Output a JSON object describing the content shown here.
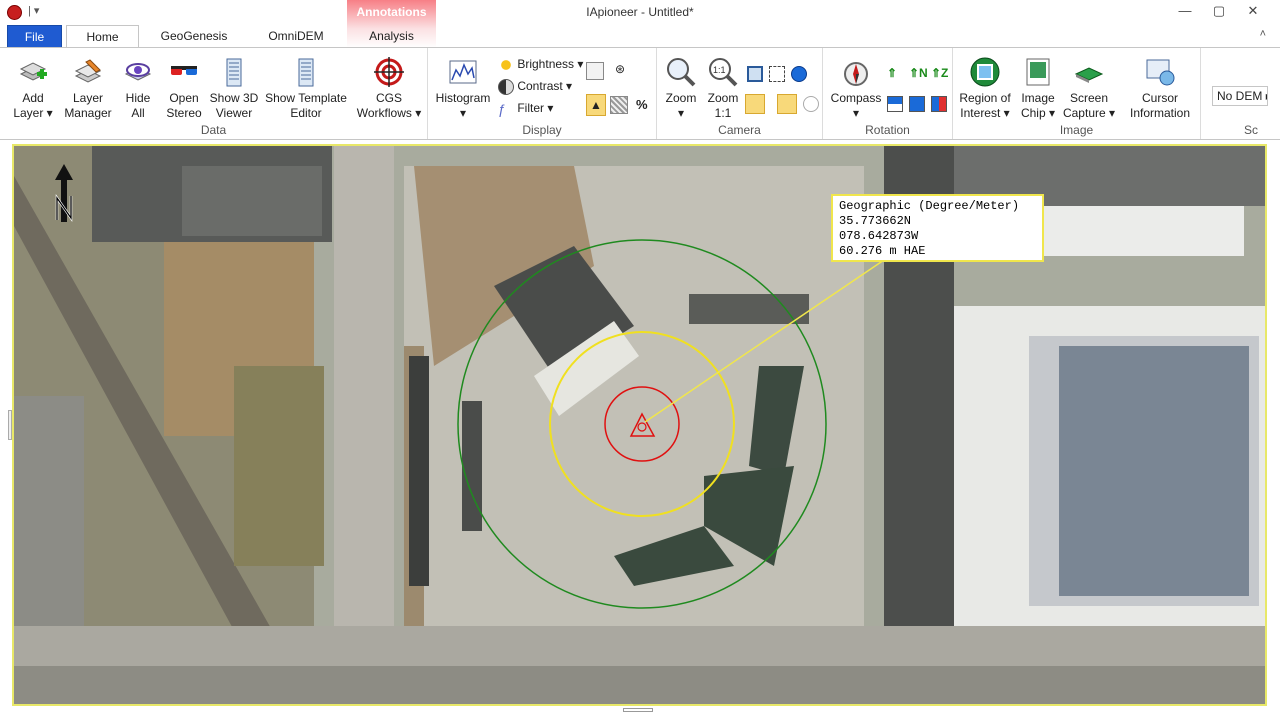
{
  "window": {
    "title": "IApioneer - Untitled*",
    "qat": "| ▾",
    "minimize": "—",
    "maximize": "▢",
    "close": "✕"
  },
  "tabs": {
    "file": "File",
    "home": "Home",
    "geogenesis": "GeoGenesis",
    "omnidem": "OmniDEM",
    "analysis": "Analysis",
    "context_group": "Annotations",
    "collapse": "˄"
  },
  "ribbon": {
    "data": {
      "label": "Data",
      "add_layer": "Add\nLayer ▾",
      "layer_manager": "Layer\nManager",
      "hide_all": "Hide\nAll",
      "open_stereo": "Open\nStereo",
      "show_3d": "Show 3D\nViewer",
      "template_editor": "Show Template\nEditor",
      "cgs": "CGS\nWorkflows ▾"
    },
    "display": {
      "label": "Display",
      "histogram": "Histogram",
      "histogram_caret": "▾",
      "brightness": "Brightness ▾",
      "contrast": "Contrast ▾",
      "filter": "Filter ▾",
      "percent": "%"
    },
    "camera": {
      "label": "Camera",
      "zoom": "Zoom",
      "zoom_caret": "▾",
      "zoom11": "Zoom\n1:1"
    },
    "rotation": {
      "label": "Rotation",
      "compass": "Compass",
      "compass_caret": "▾"
    },
    "image": {
      "label": "Image",
      "roi": "Region of\nInterest ▾",
      "chip": "Image\nChip ▾",
      "capture": "Screen\nCapture ▾",
      "cursor": "Cursor\nInformation"
    },
    "dem": {
      "value": "No DEM",
      "caret": "▸",
      "label": "Sc"
    }
  },
  "popup": {
    "line1": "Geographic (Degree/Meter)",
    "line2": "35.773662N",
    "line3": "078.642873W",
    "line4": "60.276 m HAE"
  },
  "colors": {
    "file_tab": "#1f5bd1",
    "context_tab": "#f77f86",
    "ring_outer": "#1f8a1f",
    "ring_mid": "#f0e020",
    "ring_inner": "#e01010",
    "leader": "#f0e64c"
  }
}
